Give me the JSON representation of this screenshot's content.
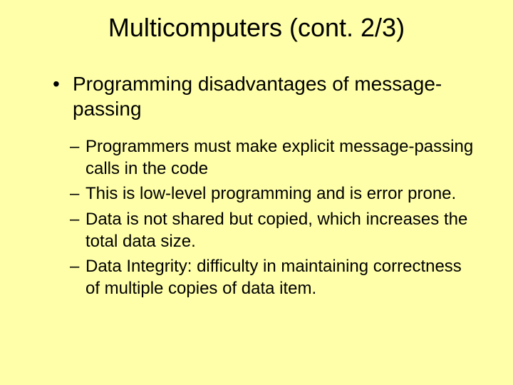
{
  "title": "Multicomputers (cont. 2/3)",
  "bullets": [
    {
      "text": "Programming disadvantages of message-passing",
      "sub": [
        "Programmers must make explicit message-passing calls in the code",
        "This is low-level programming and is error prone.",
        "Data is not shared but copied, which increases the total data size.",
        "Data Integrity: difficulty in maintaining correctness of multiple copies of data item."
      ]
    }
  ]
}
